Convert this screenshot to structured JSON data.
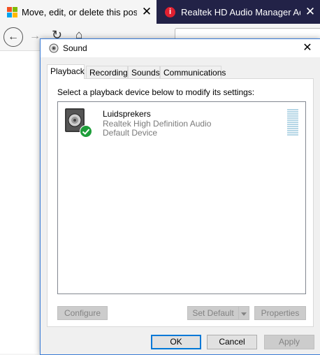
{
  "browser": {
    "tabs": [
      {
        "title": "Move, edit, or delete this post",
        "close": "✕"
      },
      {
        "title": "Realtek HD Audio Manager Ad",
        "close": "✕"
      }
    ],
    "toolbar": {
      "back": "←",
      "forward": "→",
      "reload": "↻",
      "home": "⌂"
    }
  },
  "dialog": {
    "title": "Sound",
    "close": "✕",
    "tabs": [
      "Playback",
      "Recording",
      "Sounds",
      "Communications"
    ],
    "active_tab": "Playback",
    "instruction": "Select a playback device below to modify its settings:",
    "devices": [
      {
        "name": "Luidsprekers",
        "driver": "Realtek High Definition Audio",
        "status": "Default Device"
      }
    ],
    "buttons": {
      "configure": "Configure",
      "set_default": "Set Default",
      "properties": "Properties",
      "ok": "OK",
      "cancel": "Cancel",
      "apply": "Apply"
    }
  },
  "colors": {
    "accent": "#0078d7",
    "default_check": "#1e9e3a",
    "level_meter": "#b5d6e6"
  }
}
